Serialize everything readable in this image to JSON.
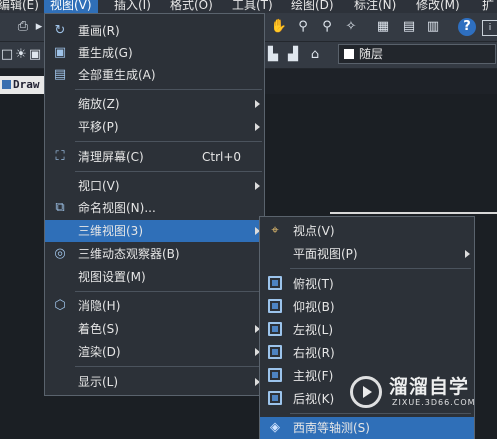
{
  "menubar": {
    "items": [
      {
        "label": "编辑(E)",
        "active": false
      },
      {
        "label": "视图(V)",
        "active": true
      },
      {
        "label": "插入(I)",
        "active": false
      },
      {
        "label": "格式(O)",
        "active": false
      },
      {
        "label": "工具(T)",
        "active": false
      },
      {
        "label": "绘图(D)",
        "active": false
      },
      {
        "label": "标注(N)",
        "active": false
      },
      {
        "label": "修改(M)",
        "active": false
      },
      {
        "label": "扩",
        "active": false
      }
    ]
  },
  "toolbar": {
    "layer_dropdown": {
      "value": "随层",
      "swatch_color": "#ffffff"
    }
  },
  "drawing_tab": {
    "label": "Draw"
  },
  "view_menu": {
    "items": [
      {
        "label": "重画(R)",
        "icon": "redraw-icon"
      },
      {
        "label": "重生成(G)",
        "icon": "regen-icon"
      },
      {
        "label": "全部重生成(A)",
        "icon": "regen-all-icon"
      },
      {
        "label": "缩放(Z)",
        "submenu": true
      },
      {
        "label": "平移(P)",
        "submenu": true
      },
      {
        "label": "清理屏幕(C)",
        "icon": "clean-screen-icon",
        "shortcut": "Ctrl+0"
      },
      {
        "label": "视口(V)",
        "submenu": true
      },
      {
        "label": "命名视图(N)...",
        "icon": "named-view-icon"
      },
      {
        "label": "三维视图(3)",
        "submenu": true,
        "highlighted": true
      },
      {
        "label": "三维动态观察器(B)",
        "icon": "orbit-icon"
      },
      {
        "label": "视图设置(M)"
      },
      {
        "label": "消隐(H)",
        "icon": "hide-icon"
      },
      {
        "label": "着色(S)",
        "submenu": true
      },
      {
        "label": "渲染(D)",
        "submenu": true
      },
      {
        "label": "显示(L)",
        "submenu": true
      }
    ]
  },
  "submenu_3d": {
    "items": [
      {
        "label": "视点(V)",
        "icon": "viewpoint-icon"
      },
      {
        "label": "平面视图(P)",
        "submenu": true
      },
      {
        "label": "俯视(T)",
        "icon": "top-view-icon"
      },
      {
        "label": "仰视(B)",
        "icon": "bottom-view-icon"
      },
      {
        "label": "左视(L)",
        "icon": "left-view-icon"
      },
      {
        "label": "右视(R)",
        "icon": "right-view-icon"
      },
      {
        "label": "主视(F)",
        "icon": "front-view-icon"
      },
      {
        "label": "后视(K)",
        "icon": "back-view-icon"
      },
      {
        "label": "西南等轴测(S)",
        "icon": "sw-iso-icon",
        "highlighted": true
      }
    ]
  },
  "watermark": {
    "title": "溜溜自学",
    "subtitle": "ZIXUE.3D66.COM"
  }
}
